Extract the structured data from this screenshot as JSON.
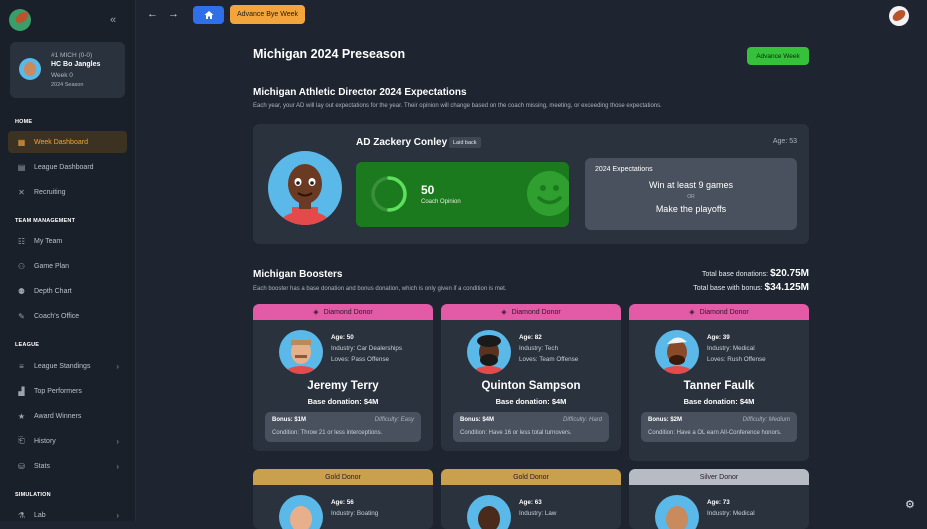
{
  "sidebar": {
    "profile": {
      "rank_record": "#1 MICH (0-0)",
      "coach": "HC Bo Jangles",
      "week": "Week 0",
      "season": "2024 Season"
    },
    "sections": {
      "home": "HOME",
      "team": "TEAM MANAGEMENT",
      "league": "LEAGUE",
      "simulation": "SIMULATION"
    },
    "items": [
      {
        "label": "Week Dashboard",
        "icon": "grid-icon"
      },
      {
        "label": "League Dashboard",
        "icon": "table-icon"
      },
      {
        "label": "Recruiting",
        "icon": "recruit-icon"
      },
      {
        "label": "My Team",
        "icon": "team-icon"
      },
      {
        "label": "Game Plan",
        "icon": "game-plan-icon"
      },
      {
        "label": "Depth Chart",
        "icon": "depth-chart-icon"
      },
      {
        "label": "Coach's Office",
        "icon": "office-icon"
      },
      {
        "label": "League Standings",
        "icon": "standings-icon"
      },
      {
        "label": "Top Performers",
        "icon": "performers-icon"
      },
      {
        "label": "Award Winners",
        "icon": "award-icon"
      },
      {
        "label": "History",
        "icon": "history-icon"
      },
      {
        "label": "Stats",
        "icon": "stats-icon"
      },
      {
        "label": "Lab",
        "icon": "lab-icon"
      }
    ]
  },
  "topbar": {
    "advance_bye_label": "Advance Bye Week"
  },
  "main": {
    "title": "Michigan 2024 Preseason",
    "advance_week_label": "Advance Week",
    "ad_section": {
      "heading": "Michigan Athletic Director 2024 Expectations",
      "description": "Each year, your AD will lay out expectations for the year. Their opinion will change based on the coach missing, meeting, or exceeding those expectations.",
      "name": "AD Zackery Conley",
      "trait": "Laid back",
      "age": "Age: 53",
      "opinion_value": "50",
      "opinion_label": "Coach Opinion",
      "opinion_fraction": 0.5,
      "expectations_title": "2024 Expectations",
      "expectation_1": "Win at least 9 games",
      "or": "OR",
      "expectation_2": "Make the playoffs"
    },
    "boosters": {
      "heading": "Michigan Boosters",
      "description": "Each booster has a base donation and bonus donation, which is only given if a condition is met.",
      "total_base_label": "Total base donations:",
      "total_base": "$20.75M",
      "total_bonus_label": "Total base with bonus:",
      "total_bonus": "$34.125M",
      "cards": [
        {
          "tier": "Diamond Donor",
          "age": "Age: 50",
          "industry": "Industry: Car Dealerships",
          "loves": "Loves: Pass Offense",
          "name": "Jeremy Terry",
          "base": "Base donation: $4M",
          "bonus": "Bonus: $1M",
          "difficulty": "Difficulty: Easy",
          "condition": "Condition: Throw 21 or less interceptions."
        },
        {
          "tier": "Diamond Donor",
          "age": "Age: 82",
          "industry": "Industry: Tech",
          "loves": "Loves: Team Offense",
          "name": "Quinton Sampson",
          "base": "Base donation: $4M",
          "bonus": "Bonus: $4M",
          "difficulty": "Difficulty: Hard",
          "condition": "Condition: Have 16 or less total turnovers."
        },
        {
          "tier": "Diamond Donor",
          "age": "Age: 39",
          "industry": "Industry: Medical",
          "loves": "Loves: Rush Offense",
          "name": "Tanner Faulk",
          "base": "Base donation: $4M",
          "bonus": "Bonus: $2M",
          "difficulty": "Difficulty: Medium",
          "condition": "Condition: Have a OL earn All-Conference honors."
        },
        {
          "tier": "Gold Donor",
          "age": "Age: 56",
          "industry": "Industry: Boating"
        },
        {
          "tier": "Gold Donor",
          "age": "Age: 63",
          "industry": "Industry: Law"
        },
        {
          "tier": "Silver Donor",
          "age": "Age: 73",
          "industry": "Industry: Medical"
        }
      ]
    }
  },
  "colors": {
    "accent": "#f3a43a",
    "home": "#2f6fe8",
    "advance": "#35c13a",
    "diamond": "#e35aa6",
    "gold": "#c9a04e",
    "silver": "#b7bcc4"
  }
}
